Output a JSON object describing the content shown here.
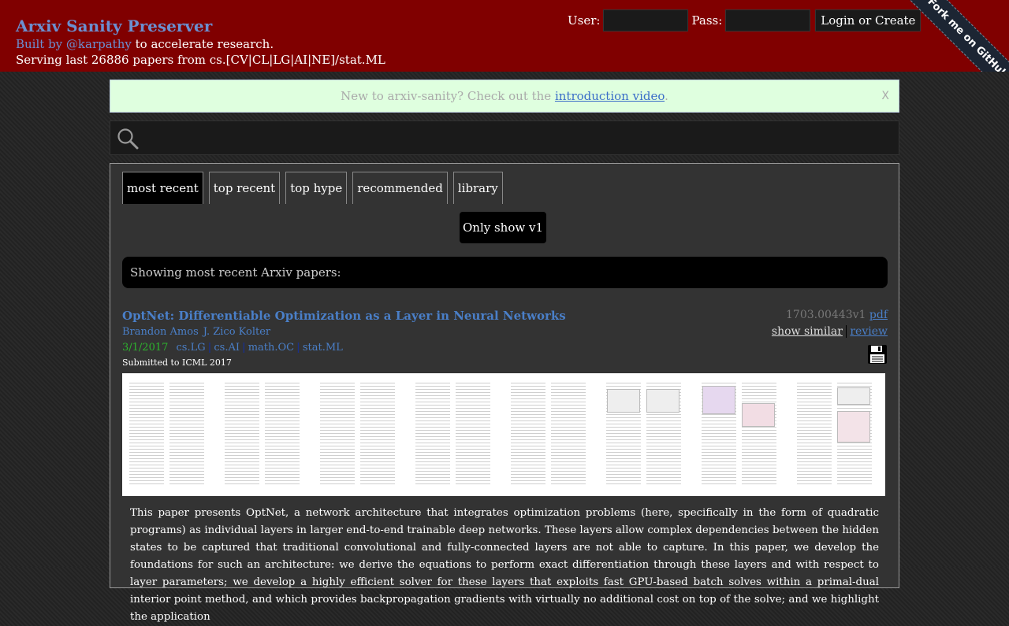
{
  "header": {
    "title": "Arxiv Sanity Preserver",
    "built_by_link": "Built by @karpathy",
    "built_by_rest": " to accelerate research.",
    "serving": "Serving last 26886 papers from cs.[CV|CL|LG|AI|NE]/stat.ML",
    "user_label": "User:",
    "pass_label": "Pass:",
    "login_button": "Login or Create",
    "ribbon": "Fork me on GitHub"
  },
  "intro": {
    "text_before": "New to arxiv-sanity? Check out the ",
    "link": "introduction video",
    "text_after": ".",
    "close": "X"
  },
  "search": {
    "value": "",
    "placeholder": ""
  },
  "tabs": [
    {
      "label": "most recent",
      "active": true
    },
    {
      "label": "top recent",
      "active": false
    },
    {
      "label": "top hype",
      "active": false
    },
    {
      "label": "recommended",
      "active": false
    },
    {
      "label": "library",
      "active": false
    }
  ],
  "v1_button": "Only show v1",
  "showing": "Showing most recent Arxiv papers:",
  "paper": {
    "title": "OptNet: Differentiable Optimization as a Layer in Neural Networks",
    "authors": [
      "Brandon Amos",
      "J. Zico Kolter"
    ],
    "date": "3/1/2017",
    "categories": [
      "cs.LG",
      "cs.AI",
      "math.OC",
      "stat.ML"
    ],
    "category_separator": "|",
    "comment": "Submitted to ICML 2017",
    "id": "1703.00443v1",
    "pdf": "pdf",
    "show_similar": "show similar",
    "review": "review",
    "save_icon": "floppy-disk-icon",
    "abstract": "This paper presents OptNet, a network architecture that integrates optimization problems (here, specifically in the form of quadratic programs) as individual layers in larger end-to-end trainable deep networks. These layers allow complex dependencies between the hidden states to be captured that traditional convolutional and fully-connected layers are not able to capture. In this paper, we develop the foundations for such an architecture: we derive the equations to perform exact differentiation through these layers and with respect to layer parameters; we develop a highly efficient solver for these layers that exploits fast GPU-based batch solves within a primal-dual interior point method, and which provides backpropagation gradients with virtually no additional cost on top of the solve; and we highlight the application"
  },
  "colors": {
    "header_bg": "#800000",
    "link_blue": "#4a7fc8",
    "date_green": "#2db52d",
    "intro_bg": "#dfffdf"
  }
}
